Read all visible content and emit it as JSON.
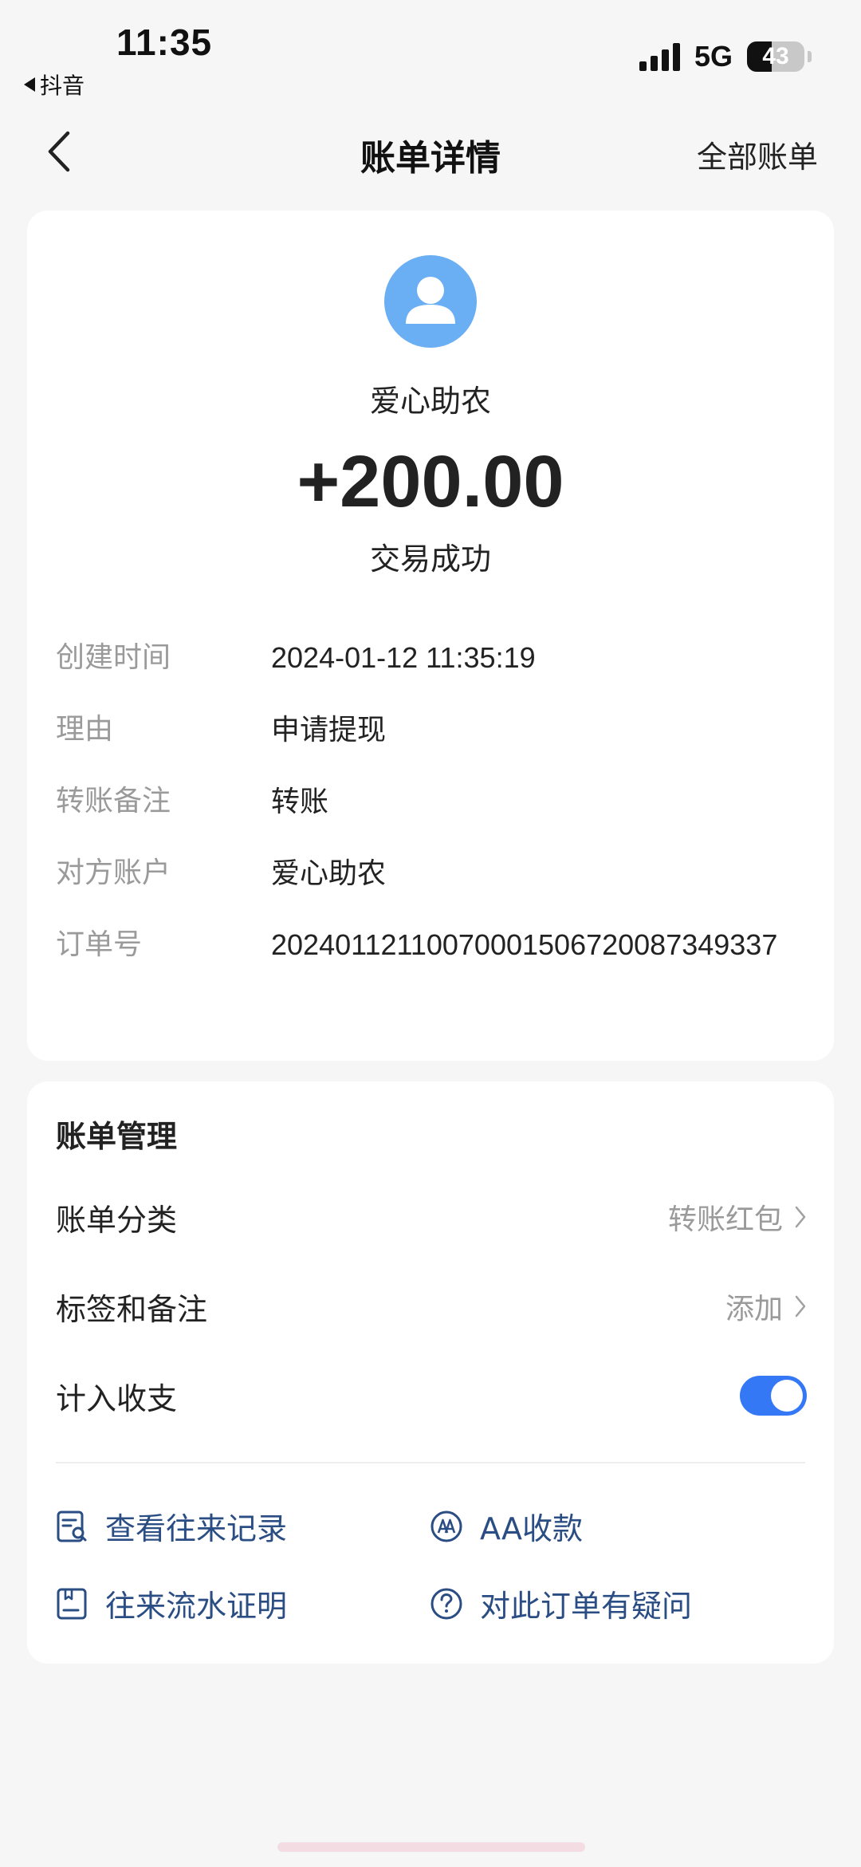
{
  "status_bar": {
    "time": "11:35",
    "back_app": "抖音",
    "network": "5G",
    "battery": "43",
    "battery_level": 0.43
  },
  "nav": {
    "title": "账单详情",
    "right_link": "全部账单"
  },
  "transaction": {
    "payee": "爱心助农",
    "amount": "+200.00",
    "status": "交易成功",
    "details": [
      {
        "label": "创建时间",
        "value": "2024-01-12 11:35:19"
      },
      {
        "label": "理由",
        "value": "申请提现"
      },
      {
        "label": "转账备注",
        "value": "转账"
      },
      {
        "label": "对方账户",
        "value": "爱心助农"
      },
      {
        "label": "订单号",
        "value": "20240112110070001506720087349337"
      }
    ]
  },
  "manage": {
    "title": "账单管理",
    "category": {
      "label": "账单分类",
      "value": "转账红包"
    },
    "tags": {
      "label": "标签和备注",
      "value": "添加"
    },
    "include": {
      "label": "计入收支",
      "on": true
    },
    "actions": {
      "history": "查看往来记录",
      "aa": "AA收款",
      "proof": "往来流水证明",
      "question": "对此订单有疑问"
    }
  },
  "colors": {
    "accent": "#3478f6",
    "link": "#2a4d84",
    "avatar": "#6aaef4"
  }
}
